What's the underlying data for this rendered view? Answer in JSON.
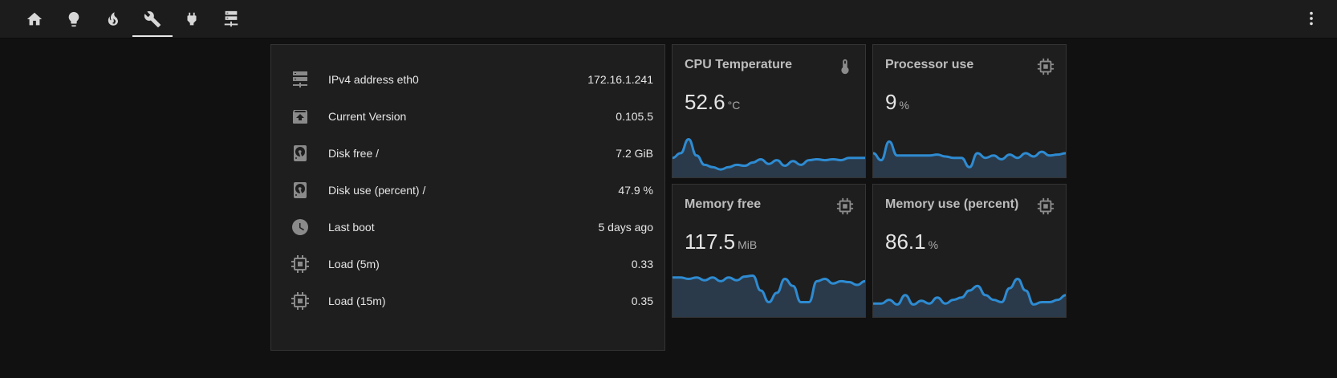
{
  "nav": {
    "tabs": [
      {
        "icon": "home-icon"
      },
      {
        "icon": "lightbulb-icon"
      },
      {
        "icon": "fire-icon"
      },
      {
        "icon": "wrench-icon",
        "active": true
      },
      {
        "icon": "power-plug-icon"
      },
      {
        "icon": "server-icon"
      }
    ],
    "menu_icon": "dots-vertical-icon"
  },
  "entities": [
    {
      "icon": "server-network-icon",
      "label": "IPv4 address eth0",
      "value": "172.16.1.241"
    },
    {
      "icon": "package-up-icon",
      "label": "Current Version",
      "value": "0.105.5"
    },
    {
      "icon": "harddisk-icon",
      "label": "Disk free /",
      "value": "7.2 GiB"
    },
    {
      "icon": "harddisk-icon",
      "label": "Disk use (percent) /",
      "value": "47.9 %"
    },
    {
      "icon": "clock-icon",
      "label": "Last boot",
      "value": "5 days ago"
    },
    {
      "icon": "chip-icon",
      "label": "Load (5m)",
      "value": "0.33"
    },
    {
      "icon": "chip-icon",
      "label": "Load (15m)",
      "value": "0.35"
    }
  ],
  "sensors": [
    {
      "title": "CPU Temperature",
      "icon": "thermometer-icon",
      "value": "52.6",
      "unit": "°C",
      "history": [
        0.35,
        0.45,
        0.75,
        0.4,
        0.2,
        0.15,
        0.1,
        0.15,
        0.2,
        0.18,
        0.25,
        0.32,
        0.22,
        0.3,
        0.18,
        0.28,
        0.2,
        0.3,
        0.32,
        0.3,
        0.32,
        0.3,
        0.35,
        0.35,
        0.35
      ]
    },
    {
      "title": "Processor use",
      "icon": "chip-icon",
      "value": "9",
      "unit": "%",
      "history": [
        0.45,
        0.3,
        0.7,
        0.4,
        0.4,
        0.4,
        0.4,
        0.4,
        0.42,
        0.38,
        0.35,
        0.35,
        0.15,
        0.45,
        0.35,
        0.4,
        0.32,
        0.42,
        0.35,
        0.45,
        0.38,
        0.48,
        0.4,
        0.42,
        0.45
      ]
    },
    {
      "title": "Memory free",
      "icon": "chip-icon",
      "value": "117.5",
      "unit": "MiB",
      "history": [
        0.78,
        0.78,
        0.75,
        0.78,
        0.72,
        0.78,
        0.7,
        0.78,
        0.72,
        0.8,
        0.82,
        0.5,
        0.25,
        0.45,
        0.75,
        0.6,
        0.25,
        0.25,
        0.7,
        0.75,
        0.65,
        0.7,
        0.68,
        0.62,
        0.7
      ]
    },
    {
      "title": "Memory use (percent)",
      "icon": "chip-icon",
      "value": "86.1",
      "unit": "%",
      "history": [
        0.22,
        0.22,
        0.3,
        0.2,
        0.4,
        0.2,
        0.28,
        0.22,
        0.35,
        0.22,
        0.3,
        0.35,
        0.5,
        0.6,
        0.4,
        0.3,
        0.25,
        0.55,
        0.75,
        0.5,
        0.2,
        0.25,
        0.25,
        0.3,
        0.4
      ]
    }
  ],
  "colors": {
    "graph_line": "#2e8bd2",
    "graph_fill": "#2a3a4a"
  }
}
